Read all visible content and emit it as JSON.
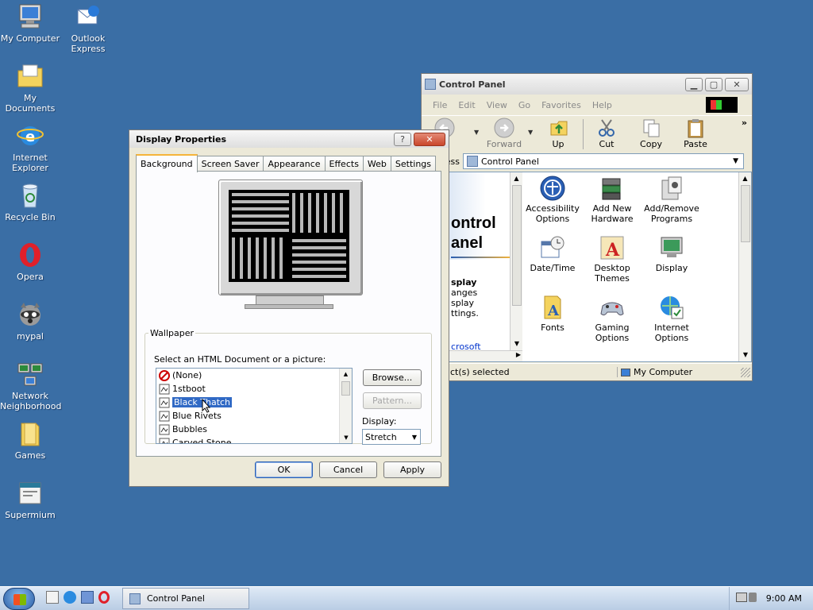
{
  "desktop": {
    "icons": [
      {
        "label": "My Computer"
      },
      {
        "label": "Outlook\nExpress"
      },
      {
        "label": "My Documents"
      },
      {
        "label": "Internet\nExplorer"
      },
      {
        "label": "Recycle Bin"
      },
      {
        "label": "Opera"
      },
      {
        "label": "mypal"
      },
      {
        "label": "Network\nNeighborhood"
      },
      {
        "label": "Games"
      },
      {
        "label": "Supermium"
      }
    ]
  },
  "control_panel": {
    "title": "Control Panel",
    "menu": [
      "File",
      "Edit",
      "View",
      "Go",
      "Favorites",
      "Help"
    ],
    "toolbar": {
      "back": "ck",
      "forward": "Forward",
      "up": "Up",
      "cut": "Cut",
      "copy": "Copy",
      "paste": "Paste"
    },
    "address_label": "ess",
    "address_value": "Control Panel",
    "sidebar": {
      "heading": "ontrol\nanel",
      "bold": "splay",
      "text": "anges\nsplay\nttings.",
      "link": "crosoft"
    },
    "items": [
      {
        "label": "Accessibility\nOptions"
      },
      {
        "label": "Add New\nHardware"
      },
      {
        "label": "Add/Remove\nPrograms"
      },
      {
        "label": "Date/Time"
      },
      {
        "label": "Desktop\nThemes"
      },
      {
        "label": "Display"
      },
      {
        "label": "Fonts"
      },
      {
        "label": "Gaming\nOptions"
      },
      {
        "label": "Internet\nOptions"
      }
    ],
    "status_left": "ct(s) selected",
    "status_right": "My Computer"
  },
  "display_properties": {
    "title": "Display Properties",
    "help_glyph": "?",
    "close_glyph": "✕",
    "tabs": [
      "Background",
      "Screen Saver",
      "Appearance",
      "Effects",
      "Web",
      "Settings"
    ],
    "active_tab": "Background",
    "wallpaper_group": "Wallpaper",
    "select_label": "Select an HTML Document or a picture:",
    "wallpapers": [
      "(None)",
      "1stboot",
      "Black Thatch",
      "Blue Rivets",
      "Bubbles",
      "Carved Stone"
    ],
    "selected_wallpaper": "Black Thatch",
    "browse": "Browse...",
    "pattern": "Pattern...",
    "display_label": "Display:",
    "display_value": "Stretch",
    "ok": "OK",
    "cancel": "Cancel",
    "apply": "Apply"
  },
  "taskbar": {
    "task": "Control Panel",
    "clock": "9:00 AM"
  },
  "colors": {
    "desktop": "#3a6ea5",
    "title_active": "#0a246a",
    "selection": "#316ac5"
  }
}
